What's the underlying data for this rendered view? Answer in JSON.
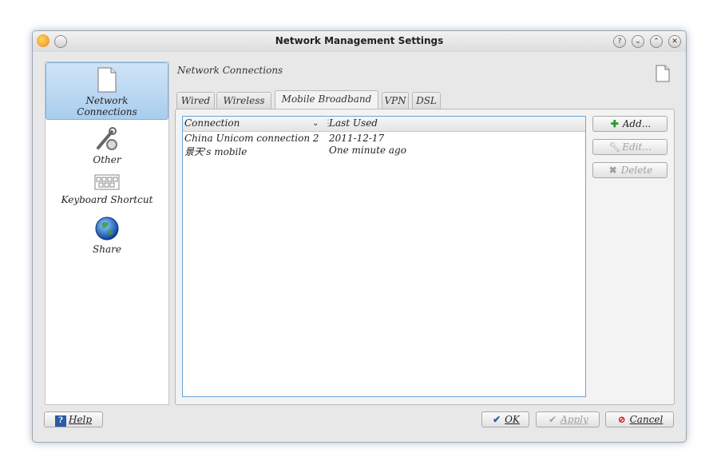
{
  "window": {
    "title": "Network Management Settings"
  },
  "titlebar_buttons": [
    "?",
    "⌄",
    "⌃",
    "✕"
  ],
  "sidebar": {
    "items": [
      {
        "label_line1": "Network",
        "label_line2": "Connections",
        "icon": "document-icon"
      },
      {
        "label": "Other",
        "icon": "wrench-gear-icon"
      },
      {
        "label": "Keyboard Shortcut",
        "icon": "keyboard-icon"
      },
      {
        "label": "Share",
        "icon": "globe-icon"
      }
    ]
  },
  "main": {
    "title": "Network Connections",
    "tabs": [
      "Wired",
      "Wireless",
      "Mobile Broadband",
      "VPN",
      "DSL"
    ],
    "active_tab": "Mobile Broadband",
    "table": {
      "columns": [
        "Connection",
        "Last Used"
      ],
      "rows": [
        [
          "China Unicom connection 2",
          "2011-12-17"
        ],
        [
          "景天's mobile",
          "One minute ago"
        ]
      ]
    },
    "buttons": {
      "add": "Add...",
      "edit": "Edit...",
      "delete": "Delete"
    }
  },
  "footer": {
    "help": "Help",
    "ok": "OK",
    "apply": "Apply",
    "cancel": "Cancel"
  },
  "colors": {
    "selection": "#a9cdee",
    "list_border": "#6aa5da",
    "add_green": "#2a9a2a",
    "cancel_red": "#d02020"
  }
}
